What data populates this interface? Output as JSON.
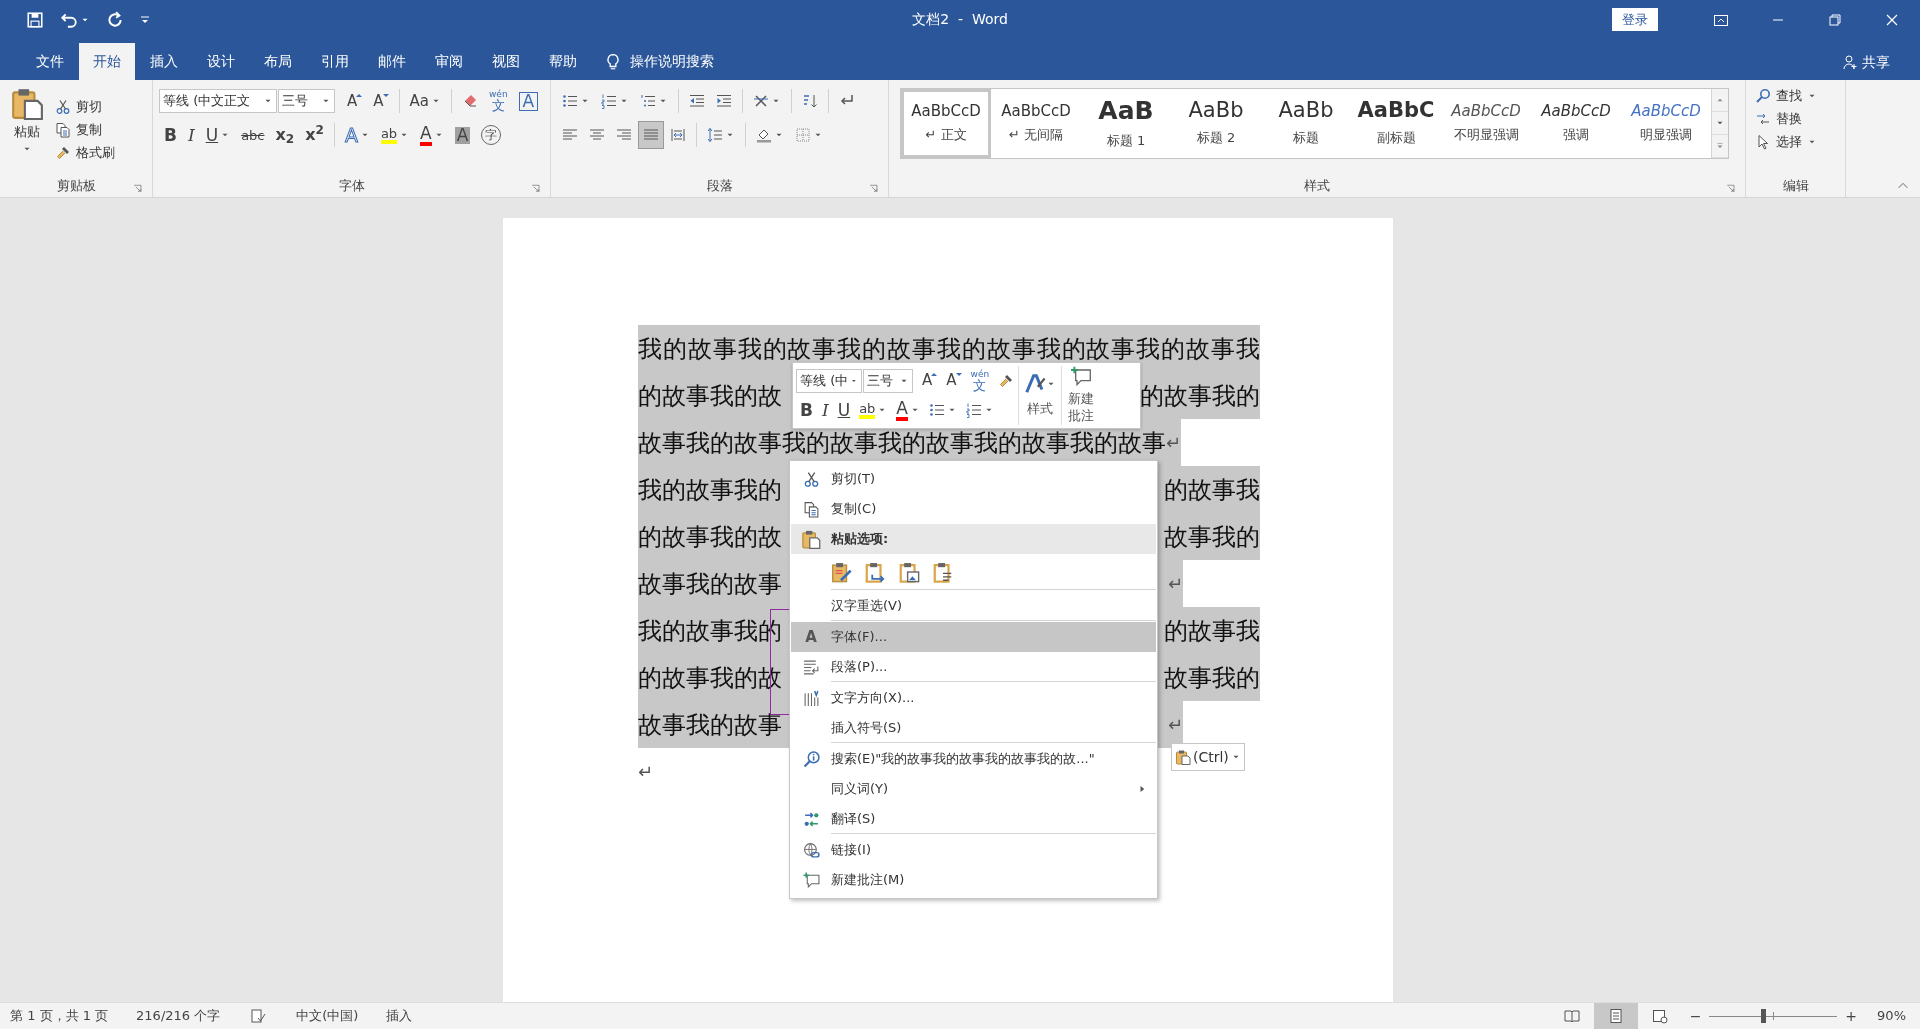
{
  "title_bar": {
    "quick_access": [
      {
        "kind": "save",
        "dropdown": false
      },
      {
        "kind": "undo",
        "dropdown": true
      },
      {
        "kind": "redo",
        "dropdown": false
      },
      {
        "kind": "customize",
        "dropdown": false
      }
    ],
    "title": "文档2  -  Word",
    "sign_in": "登录"
  },
  "tabs": [
    {
      "label": "文件",
      "selected": false
    },
    {
      "label": "开始",
      "selected": true
    },
    {
      "label": "插入",
      "selected": false
    },
    {
      "label": "设计",
      "selected": false
    },
    {
      "label": "布局",
      "selected": false
    },
    {
      "label": "引用",
      "selected": false
    },
    {
      "label": "邮件",
      "selected": false
    },
    {
      "label": "审阅",
      "selected": false
    },
    {
      "label": "视图",
      "selected": false
    },
    {
      "label": "帮助",
      "selected": false
    }
  ],
  "tell_me": "操作说明搜索",
  "share": "共享",
  "ribbon": {
    "clipboard": {
      "paste": "粘贴",
      "cut": "剪切",
      "copy": "复制",
      "format_painter": "格式刷",
      "label": "剪贴板"
    },
    "font": {
      "font_name": "等线 (中文正文",
      "font_size": "三号",
      "label": "字体",
      "row1": [
        {
          "kind": "grow",
          "text": "A",
          "dropdown": false
        },
        {
          "kind": "shrink",
          "text": "A",
          "dropdown": false
        },
        {
          "kind": "separator"
        },
        {
          "kind": "case",
          "text": "Aa",
          "dropdown": true
        },
        {
          "kind": "separator"
        },
        {
          "kind": "clear",
          "dropdown": false
        },
        {
          "kind": "phonetic",
          "text": "wén",
          "base": "文",
          "dropdown": false
        },
        {
          "kind": "border",
          "text": "A",
          "dropdown": false
        }
      ],
      "row2": [
        {
          "kind": "bold",
          "text": "B",
          "dropdown": false
        },
        {
          "kind": "italic",
          "text": "I",
          "dropdown": false
        },
        {
          "kind": "underline",
          "text": "U",
          "dropdown": true
        },
        {
          "kind": "strike",
          "text": "abc",
          "dropdown": false
        },
        {
          "kind": "subscript",
          "text": "x$_{2}$",
          "dropdown": false
        },
        {
          "kind": "superscript",
          "text": "x$^{2}$",
          "dropdown": false
        },
        {
          "kind": "separator"
        },
        {
          "kind": "effects",
          "text": "A",
          "dropdown": true
        },
        {
          "kind": "highlight",
          "text": "ab",
          "dropdown": true
        },
        {
          "kind": "color",
          "text": "A",
          "dropdown": true
        },
        {
          "kind": "shading",
          "text": "A",
          "dropdown": false
        },
        {
          "kind": "enclose",
          "text": "字",
          "dropdown": false
        }
      ]
    },
    "paragraph": {
      "label": "段落",
      "row1": [
        {
          "kind": "bullets",
          "dropdown": true
        },
        {
          "kind": "numbering",
          "dropdown": true
        },
        {
          "kind": "multilevel",
          "dropdown": true
        },
        {
          "kind": "separator"
        },
        {
          "kind": "decrease_indent",
          "dropdown": false
        },
        {
          "kind": "increase_indent",
          "dropdown": false
        },
        {
          "kind": "separator"
        },
        {
          "kind": "asian",
          "dropdown": true
        },
        {
          "kind": "separator"
        },
        {
          "kind": "sort",
          "dropdown": false
        },
        {
          "kind": "separator"
        },
        {
          "kind": "marks",
          "dropdown": false
        }
      ],
      "row2": [
        {
          "kind": "align_left",
          "dropdown": false,
          "selected": false
        },
        {
          "kind": "align_center",
          "dropdown": false,
          "selected": false
        },
        {
          "kind": "align_right",
          "dropdown": false,
          "selected": false
        },
        {
          "kind": "justify",
          "dropdown": false,
          "selected": true
        },
        {
          "kind": "distribute",
          "dropdown": false,
          "selected": false
        },
        {
          "kind": "separator"
        },
        {
          "kind": "line_spacing",
          "dropdown": true
        },
        {
          "kind": "separator"
        },
        {
          "kind": "shading_fill",
          "dropdown": true
        },
        {
          "kind": "borders",
          "dropdown": true
        }
      ]
    },
    "styles": {
      "label": "样式",
      "items": [
        {
          "kind": "normal",
          "preview": "AaBbCcD",
          "mark": "↵",
          "name": "正文",
          "selected": true
        },
        {
          "kind": "no_spacing",
          "preview": "AaBbCcD",
          "mark": "↵",
          "name": "无间隔",
          "selected": false
        },
        {
          "kind": "heading1",
          "preview": "AaB",
          "name": "标题 1",
          "selected": false
        },
        {
          "kind": "heading2",
          "preview": "AaBb",
          "name": "标题 2",
          "selected": false
        },
        {
          "kind": "title",
          "preview": "AaBb",
          "name": "标题",
          "selected": false
        },
        {
          "kind": "subtitle",
          "preview": "AaBbC",
          "name": "副标题",
          "selected": false
        },
        {
          "kind": "subtle",
          "preview": "AaBbCcD",
          "name": "不明显强调",
          "selected": false
        },
        {
          "kind": "emphasis",
          "preview": "AaBbCcD",
          "name": "强调",
          "selected": false
        },
        {
          "kind": "intense",
          "preview": "AaBbCcD",
          "name": "明显强调",
          "selected": false
        }
      ]
    },
    "editing": {
      "find": "查找",
      "replace": "替换",
      "select": "选择",
      "label": "编辑"
    }
  },
  "document": {
    "lines": [
      {
        "text": "我的故事我的故事我的故事我的故事我的故事我的故事我",
        "selected": true
      },
      {
        "left": "的故事我的故",
        "right": "的故事我的",
        "selected": true
      },
      {
        "text": "故事我的故事我的故事我的故事我的故事我的故事",
        "mark": "↵",
        "selected": true
      },
      {
        "left": "我的故事我的",
        "right": "的故事我",
        "selected": true
      },
      {
        "left": "的故事我的故",
        "right": "故事我的",
        "selected": true
      },
      {
        "left": "故事我的故事",
        "mark": "↵",
        "selected": true
      },
      {
        "left": "我的故事我的",
        "right": "的故事我",
        "selected": true
      },
      {
        "left": "的故事我的故",
        "right": "故事我的",
        "selected": true
      },
      {
        "left": "故事我的故事",
        "mark": "↵",
        "selected": true
      },
      {
        "mark": "↵",
        "selected": false
      }
    ],
    "paste_options_button": "(Ctrl)"
  },
  "mini_toolbar": {
    "font_name": "等线 (中",
    "font_size": "三号",
    "row1": [
      {
        "kind": "grow",
        "text": "A",
        "dropdown": false
      },
      {
        "kind": "shrink",
        "text": "A",
        "dropdown": false
      },
      {
        "kind": "phonetic",
        "text": "wén",
        "base": "文",
        "dropdown": false
      },
      {
        "kind": "painter",
        "dropdown": false
      }
    ],
    "row2": [
      {
        "kind": "bold",
        "text": "B",
        "dropdown": false
      },
      {
        "kind": "italic",
        "text": "I",
        "dropdown": false
      },
      {
        "kind": "underline",
        "text": "U",
        "dropdown": false
      },
      {
        "kind": "highlight",
        "text": "ab",
        "dropdown": true
      },
      {
        "kind": "color",
        "text": "A",
        "dropdown": true
      },
      {
        "kind": "bullets",
        "dropdown": true
      },
      {
        "kind": "numbering",
        "dropdown": true
      }
    ],
    "styles": "样式",
    "new_comment": "新建批注"
  },
  "context_menu": [
    {
      "kind": "cut",
      "label": "剪切(T)",
      "selected": false,
      "divider_after": false,
      "submenu": false
    },
    {
      "kind": "copy",
      "label": "复制(C)",
      "selected": false,
      "divider_after": false,
      "submenu": false
    },
    {
      "kind": "paste_header",
      "label": "粘贴选项:"
    },
    {
      "kind": "paste_options",
      "options": [
        {
          "kind": "keep_source"
        },
        {
          "kind": "merge"
        },
        {
          "kind": "picture"
        },
        {
          "kind": "text_only"
        }
      ],
      "divider_after": true
    },
    {
      "kind": "plain",
      "label": "汉字重选(V)",
      "selected": false,
      "divider_after": true,
      "submenu": false
    },
    {
      "kind": "font",
      "glyph": "A",
      "label": "字体(F)...",
      "selected": true,
      "divider_after": false,
      "submenu": false
    },
    {
      "kind": "paragraph",
      "label": "段落(P)...",
      "selected": false,
      "divider_after": true,
      "submenu": false
    },
    {
      "kind": "text_direction",
      "label": "文字方向(X)...",
      "selected": false,
      "divider_after": false,
      "submenu": false
    },
    {
      "kind": "plain",
      "label": "插入符号(S)",
      "selected": false,
      "divider_after": true,
      "submenu": false
    },
    {
      "kind": "search",
      "label": "搜索(E)\"我的故事我的故事我的故事我的故...\"",
      "selected": false,
      "divider_after": false,
      "submenu": false
    },
    {
      "kind": "plain",
      "label": "同义词(Y)",
      "selected": false,
      "divider_after": false,
      "submenu": true
    },
    {
      "kind": "translate",
      "label": "翻译(S)",
      "selected": false,
      "divider_after": true,
      "submenu": false
    },
    {
      "kind": "link",
      "label": "链接(I)",
      "selected": false,
      "divider_after": false,
      "submenu": false
    },
    {
      "kind": "comment",
      "label": "新建批注(M)",
      "selected": false,
      "divider_after": false,
      "submenu": false
    }
  ],
  "status_bar": {
    "left": [
      {
        "kind": "text",
        "text": "第 1 页，共 1 页"
      },
      {
        "kind": "text",
        "text": "216/216 个字"
      },
      {
        "kind": "proofing"
      },
      {
        "kind": "text",
        "text": "中文(中国)"
      },
      {
        "kind": "text",
        "text": "插入"
      }
    ],
    "views": [
      {
        "kind": "read",
        "selected": false
      },
      {
        "kind": "print",
        "selected": true
      },
      {
        "kind": "web",
        "selected": false
      }
    ],
    "zoom_out": "−",
    "zoom": {
      "level": 0.42
    },
    "zoom_in": "+",
    "zoom_label": "90%"
  }
}
